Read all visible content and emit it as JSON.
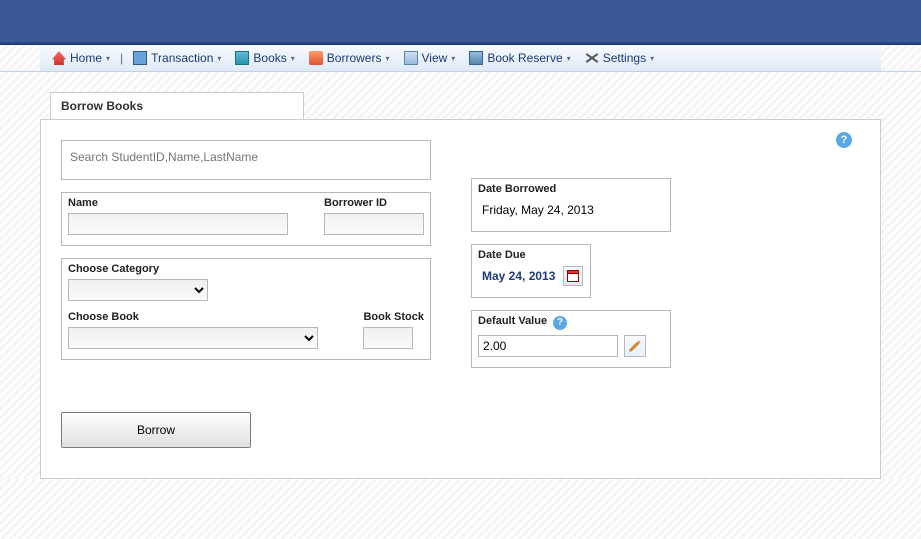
{
  "menu": {
    "home": "Home",
    "transaction": "Transaction",
    "books": "Books",
    "borrowers": "Borrowers",
    "view": "View",
    "book_reserve": "Book Reserve",
    "settings": "Settings"
  },
  "page": {
    "title": "Borrow Books"
  },
  "search": {
    "placeholder": "Search StudentID,Name,LastName",
    "value": ""
  },
  "borrower": {
    "name_label": "Name",
    "name_value": "",
    "id_label": "Borrower ID",
    "id_value": ""
  },
  "book": {
    "category_label": "Choose Category",
    "category_value": "",
    "book_label": "Choose Book",
    "book_value": "",
    "stock_label": "Book Stock",
    "stock_value": ""
  },
  "dates": {
    "borrowed_label": "Date Borrowed",
    "borrowed_value": "Friday, May 24, 2013",
    "due_label": "Date Due",
    "due_value": "May 24, 2013"
  },
  "default_value": {
    "label": "Default Value",
    "value": "2.00"
  },
  "actions": {
    "borrow": "Borrow"
  }
}
